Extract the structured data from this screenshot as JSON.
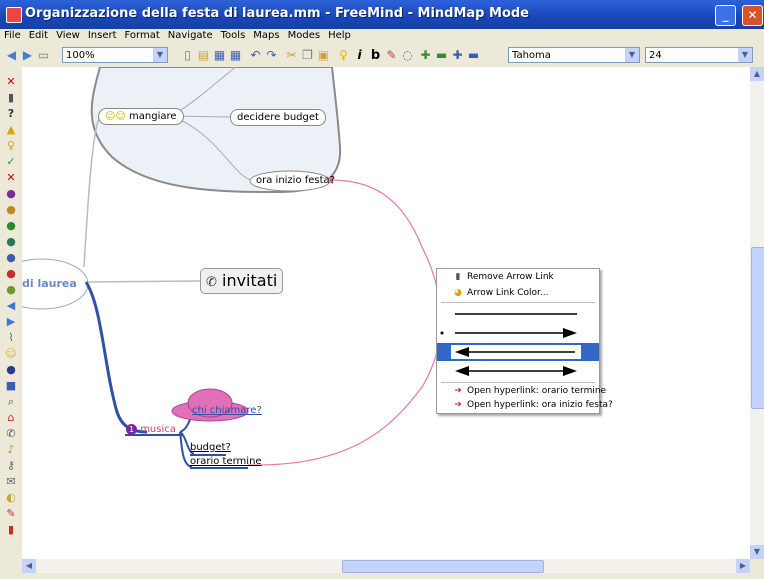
{
  "window": {
    "title": "Organizzazione della festa di laurea.mm - FreeMind - MindMap Mode",
    "minimize": "_",
    "maximize": "□",
    "close": "✕"
  },
  "menu": [
    "File",
    "Edit",
    "View",
    "Insert",
    "Format",
    "Navigate",
    "Tools",
    "Maps",
    "Modes",
    "Help"
  ],
  "toolbar": {
    "zoom": "100%",
    "font": "Tahoma",
    "size": "24",
    "bold": "b",
    "italic": "i"
  },
  "nodes": {
    "root": "di laurea",
    "mangiare": "mangiare",
    "decidere_budget": "decidere budget",
    "ora_inizio": "ora inizio festa?",
    "invitati": "invitati",
    "musica": "musica",
    "musica_priority": "1",
    "chi_chiamare": "chi chiamare?",
    "budget": "budget?",
    "orario_termine": "orario termine"
  },
  "context_menu": {
    "remove_link": "Remove Arrow Link",
    "link_color": "Arrow Link Color...",
    "open_orario": "Open hyperlink: orario termine",
    "open_ora_inizio": "Open hyperlink: ora inizio festa?"
  },
  "colors": {
    "title_bar": "#1846b8",
    "cloud_fill": "#ecf1f8",
    "arrow_link": "#e8799e",
    "musica_edge": "#3050a8",
    "chi_chiamare_fill": "#e070b8",
    "menu_selection": "#3169c6"
  }
}
